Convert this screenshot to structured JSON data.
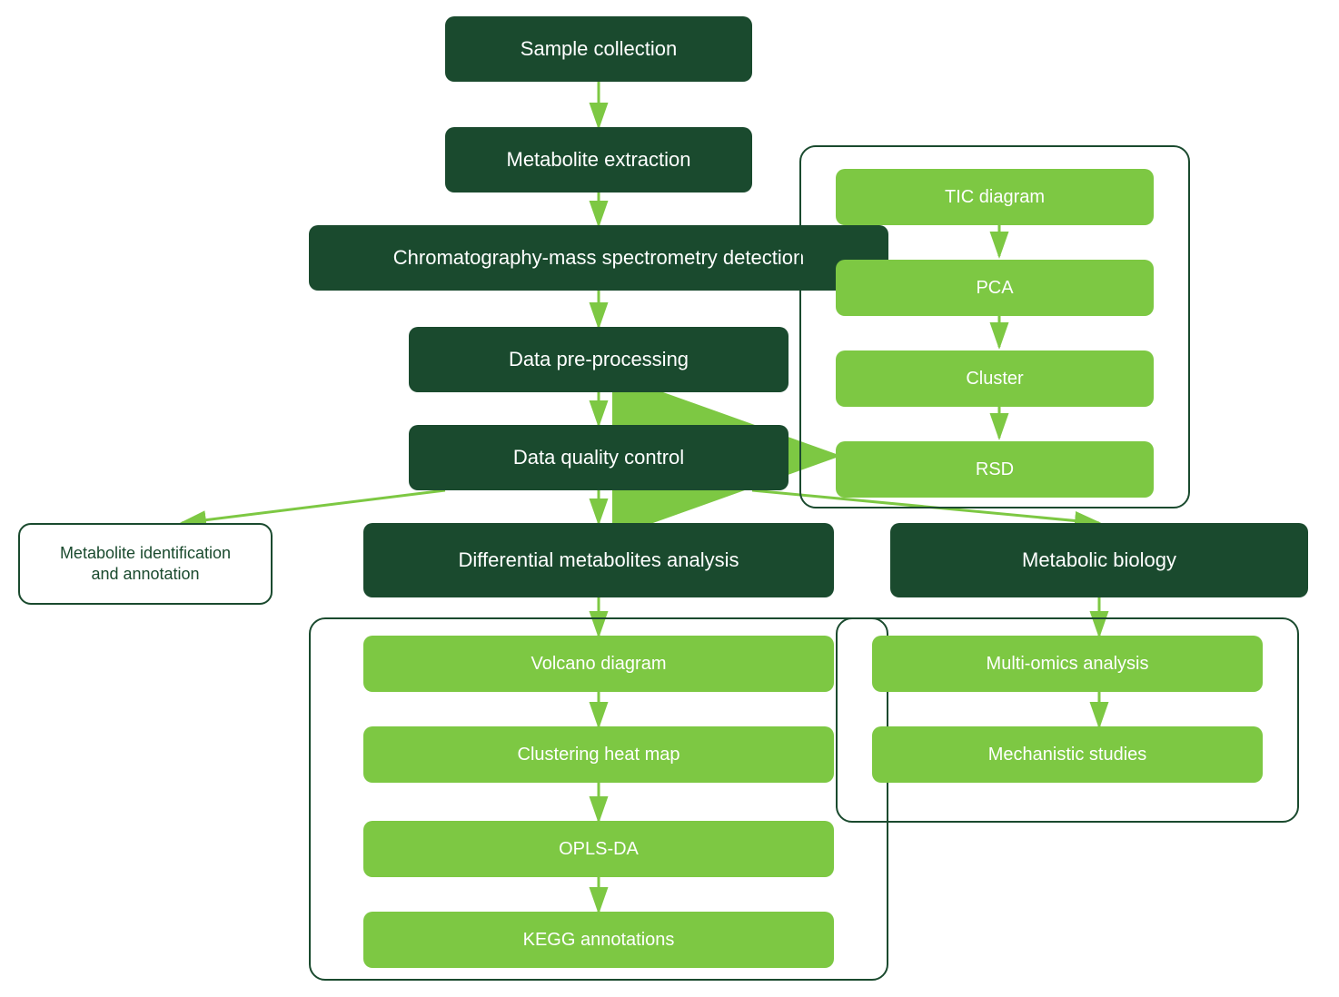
{
  "nodes": {
    "sample_collection": {
      "label": "Sample collection"
    },
    "metabolite_extraction": {
      "label": "Metabolite extraction"
    },
    "chromatography": {
      "label": "Chromatography-mass spectrometry detection"
    },
    "data_preprocessing": {
      "label": "Data pre-processing"
    },
    "data_quality": {
      "label": "Data quality control"
    },
    "metabolite_id": {
      "label": "Metabolite identification\nand annotation"
    },
    "differential": {
      "label": "Differential metabolites analysis"
    },
    "metabolic_biology": {
      "label": "Metabolic biology"
    },
    "tic": {
      "label": "TIC diagram"
    },
    "pca": {
      "label": "PCA"
    },
    "cluster": {
      "label": "Cluster"
    },
    "rsd": {
      "label": "RSD"
    },
    "volcano": {
      "label": "Volcano diagram"
    },
    "clustering_heatmap": {
      "label": "Clustering heat map"
    },
    "opls_da": {
      "label": "OPLS-DA"
    },
    "kegg": {
      "label": "KEGG annotations"
    },
    "multi_omics": {
      "label": "Multi-omics analysis"
    },
    "mechanistic": {
      "label": "Mechanistic studies"
    }
  }
}
